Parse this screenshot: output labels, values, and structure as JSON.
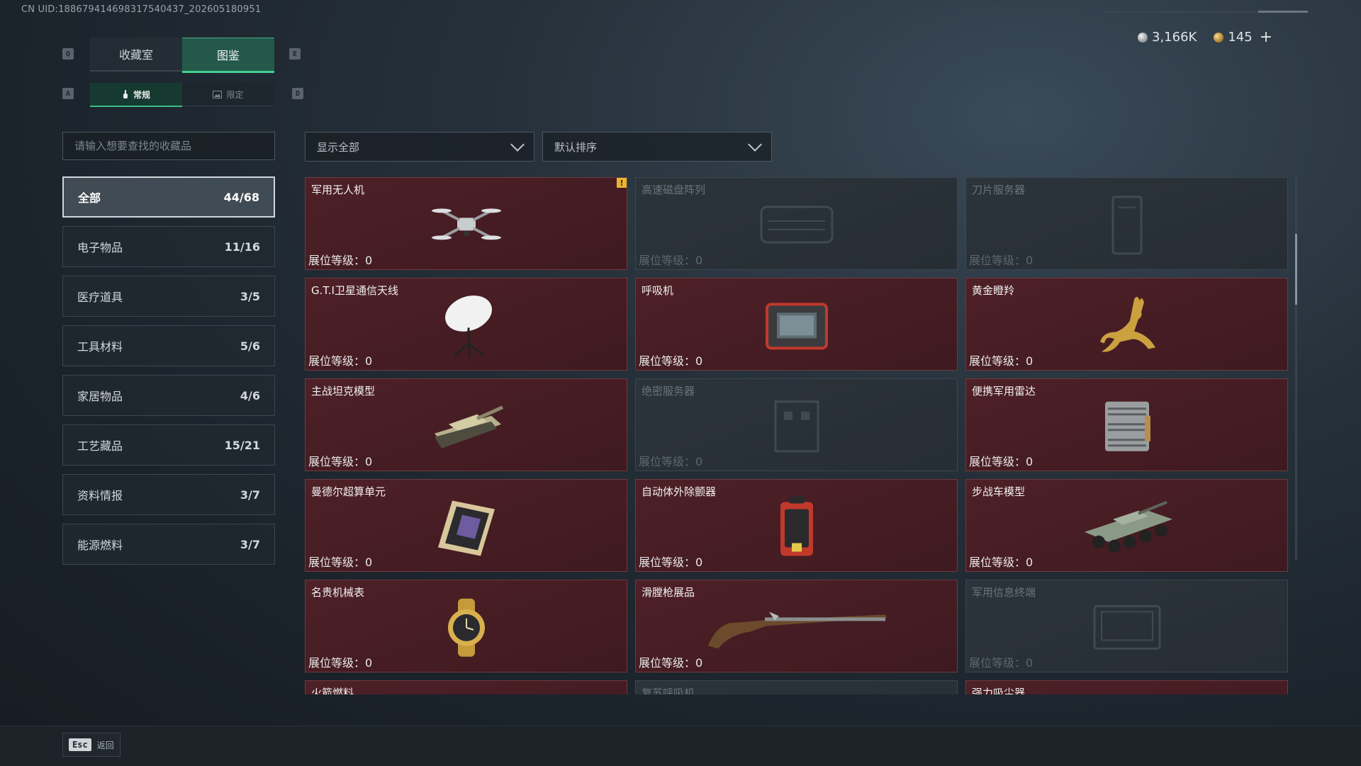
{
  "uid": "CN UID:1886794146983175404​37_202605180951",
  "currency": {
    "silver": "3,166K",
    "gold": "145",
    "plus": "+"
  },
  "keys": {
    "q": "Q",
    "e": "E",
    "a": "A",
    "d": "D"
  },
  "tabs": [
    {
      "label": "收藏室"
    },
    {
      "label": "图鉴"
    }
  ],
  "subtabs": [
    {
      "label": "常规"
    },
    {
      "label": "限定"
    }
  ],
  "search": {
    "placeholder": "请输入想要查找的收藏品"
  },
  "categories": [
    {
      "label": "全部",
      "count": "44/68"
    },
    {
      "label": "电子物品",
      "count": "11/16"
    },
    {
      "label": "医疗道具",
      "count": "3/5"
    },
    {
      "label": "工具材料",
      "count": "5/6"
    },
    {
      "label": "家居物品",
      "count": "4/6"
    },
    {
      "label": "工艺藏品",
      "count": "15/21"
    },
    {
      "label": "资料情报",
      "count": "3/7"
    },
    {
      "label": "能源燃料",
      "count": "3/7"
    }
  ],
  "filters": {
    "show": "显示全部",
    "sort": "默认排序"
  },
  "level_label": "展位等级：",
  "items": [
    {
      "name": "军用无人机",
      "level": "0",
      "locked": false,
      "icon": "drone-icon",
      "badge": "!"
    },
    {
      "name": "高速磁盘阵列",
      "level": "0",
      "locked": true,
      "icon": "disk-array-icon"
    },
    {
      "name": "刀片服务器",
      "level": "0",
      "locked": true,
      "icon": "blade-server-icon"
    },
    {
      "name": "G.T.I卫星通信天线",
      "level": "0",
      "locked": false,
      "icon": "satellite-dish-icon"
    },
    {
      "name": "呼吸机",
      "level": "0",
      "locked": false,
      "icon": "ventilator-icon"
    },
    {
      "name": "黄金瞪羚",
      "level": "0",
      "locked": false,
      "icon": "golden-gazelle-icon"
    },
    {
      "name": "主战坦克模型",
      "level": "0",
      "locked": false,
      "icon": "tank-model-icon"
    },
    {
      "name": "绝密服务器",
      "level": "0",
      "locked": true,
      "icon": "secret-server-icon"
    },
    {
      "name": "便携军用雷达",
      "level": "0",
      "locked": false,
      "icon": "radar-icon"
    },
    {
      "name": "曼德尔超算单元",
      "level": "0",
      "locked": false,
      "icon": "supercomputer-unit-icon"
    },
    {
      "name": "自动体外除颤器",
      "level": "0",
      "locked": false,
      "icon": "defibrillator-icon"
    },
    {
      "name": "步战车模型",
      "level": "0",
      "locked": false,
      "icon": "ifv-model-icon"
    },
    {
      "name": "名贵机械表",
      "level": "0",
      "locked": false,
      "icon": "watch-icon"
    },
    {
      "name": "滑膛枪展品",
      "level": "0",
      "locked": false,
      "icon": "musket-icon"
    },
    {
      "name": "军用信息终端",
      "level": "0",
      "locked": true,
      "icon": "terminal-icon"
    },
    {
      "name": "火箭燃料",
      "level": "",
      "locked": false,
      "icon": "rocket-fuel-icon"
    },
    {
      "name": "复苏呼吸机",
      "level": "",
      "locked": true,
      "icon": "resuscitator-icon"
    },
    {
      "name": "强力吸尘器",
      "level": "",
      "locked": false,
      "icon": "vacuum-icon"
    }
  ],
  "footer": {
    "esc_key": "Esc",
    "back_label": "返回"
  }
}
